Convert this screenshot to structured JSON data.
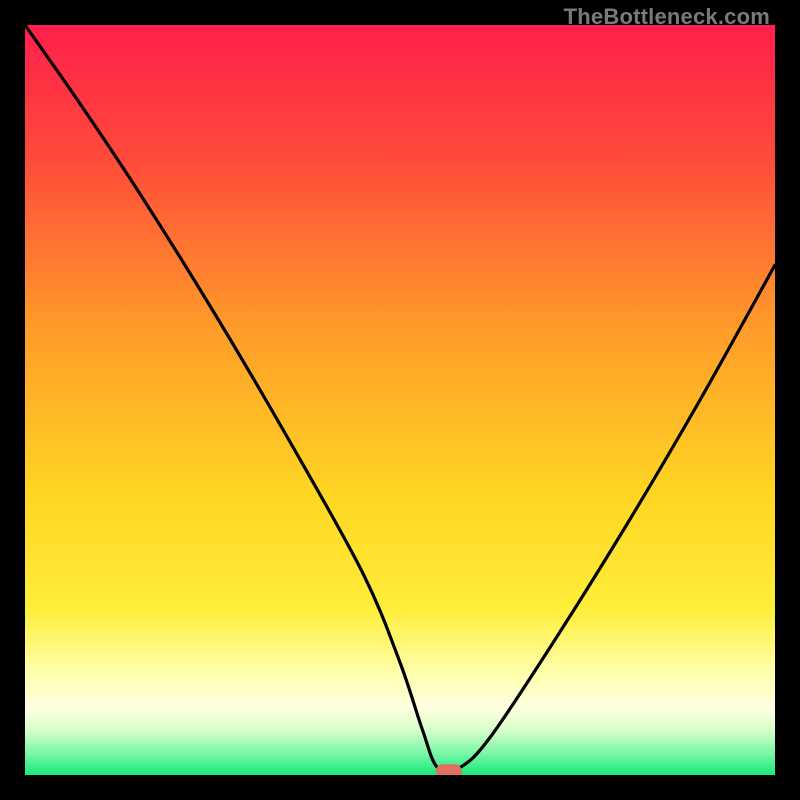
{
  "watermark": "TheBottleneck.com",
  "chart_data": {
    "type": "line",
    "title": "",
    "xlabel": "",
    "ylabel": "",
    "xlim": [
      0,
      100
    ],
    "ylim": [
      0,
      100
    ],
    "grid": false,
    "legend": false,
    "series": [
      {
        "name": "bottleneck-curve",
        "x": [
          0,
          7,
          15,
          25,
          35,
          45,
          50,
          53,
          55,
          58,
          62,
          70,
          80,
          90,
          100
        ],
        "values": [
          100,
          90,
          78,
          62,
          45,
          27,
          15,
          6,
          1,
          1,
          5,
          17,
          33,
          50,
          68
        ]
      }
    ],
    "annotations": [
      {
        "name": "min-marker",
        "x": 56.5,
        "y": 0.5
      }
    ],
    "background_gradient": {
      "top": "#ff1f4b",
      "mid1": "#ff8a2a",
      "mid2": "#ffe423",
      "pale": "#ffffd0",
      "bottom": "#17e87a"
    }
  }
}
